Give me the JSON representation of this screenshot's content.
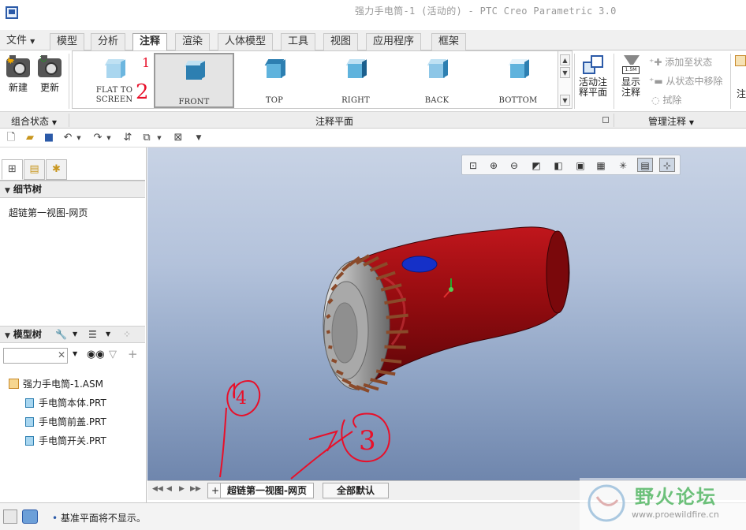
{
  "window": {
    "title": "强力手电筒-1 (活动的) - PTC Creo Parametric 3.0"
  },
  "tabs": [
    {
      "label": "文件",
      "has_menu": true
    },
    {
      "label": "模型"
    },
    {
      "label": "分析"
    },
    {
      "label": "注释",
      "active": true
    },
    {
      "label": "渲染"
    },
    {
      "label": "人体模型"
    },
    {
      "label": "工具"
    },
    {
      "label": "视图"
    },
    {
      "label": "应用程序"
    },
    {
      "label": "框架"
    }
  ],
  "ribbon": {
    "combined_state": {
      "new_label": "新建",
      "update_label": "更新",
      "group_label": "组合状态"
    },
    "views": [
      {
        "line1": "FLAT  TO",
        "line2": "SCREEN"
      },
      {
        "label": "FRONT",
        "selected": true
      },
      {
        "label": "TOP"
      },
      {
        "label": "RIGHT"
      },
      {
        "label": "BACK"
      },
      {
        "label": "BOTTOM"
      }
    ],
    "annotation_plane_group": "注释平面",
    "active_plane": {
      "line1": "活动注",
      "line2": "释平面"
    },
    "show_annotation": {
      "line1": "显示",
      "line2": "注释"
    },
    "add_to_state": "添加至状态",
    "remove_from_state": "从状态中移除",
    "erase": "拭除",
    "manage_group": "管理注释"
  },
  "left_panel": {
    "detail_tree_title": "细节树",
    "detail_tree_items": [
      "超链第一视图-网页"
    ],
    "model_tree_title": "模型树",
    "model_tree_items": [
      {
        "label": "强力手电筒-1.ASM",
        "kind": "asm"
      },
      {
        "label": "手电筒本体.PRT",
        "kind": "prt"
      },
      {
        "label": "手电筒前盖.PRT",
        "kind": "prt"
      },
      {
        "label": "手电筒开关.PRT",
        "kind": "prt"
      }
    ]
  },
  "sheets": {
    "add_label": "+",
    "tabs": [
      {
        "label": "超链第一视图-网页",
        "active": true
      },
      {
        "label": "全部默认"
      }
    ]
  },
  "status": {
    "message": "基准平面将不显示。"
  },
  "annotations": {
    "arrow1": "1",
    "marker2": "2",
    "marker3": "3",
    "marker4": "4"
  },
  "watermark": {
    "title": "野火论坛",
    "url": "www.proewildfire.cn"
  },
  "colors": {
    "body": "#8e0a0e",
    "button": "#1530c8",
    "accent": "#2b5aa8",
    "ink": "#e8102a"
  }
}
